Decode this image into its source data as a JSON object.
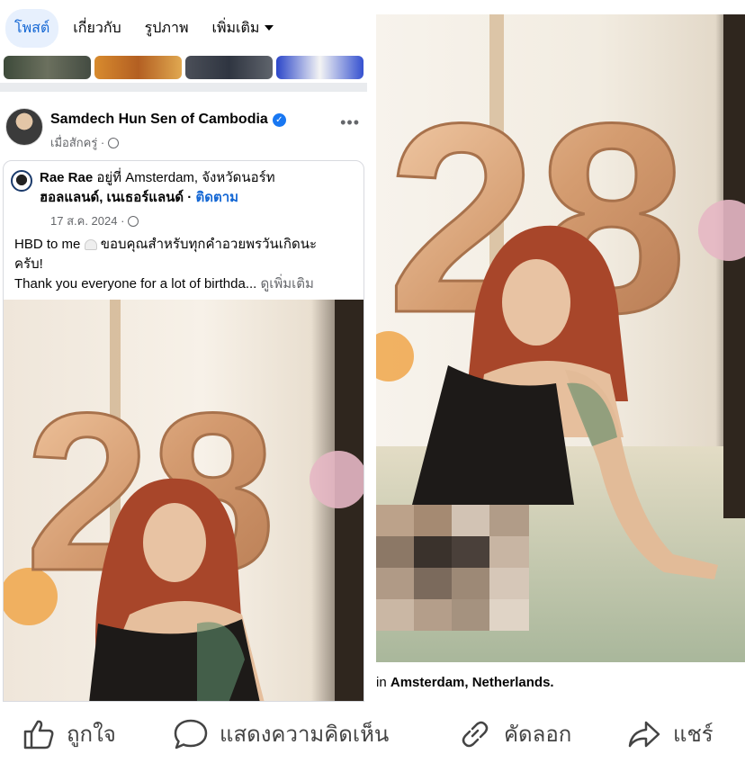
{
  "tabs": [
    {
      "label": "โพสต์",
      "active": true
    },
    {
      "label": "เกี่ยวกับ",
      "active": false
    },
    {
      "label": "รูปภาพ",
      "active": false
    },
    {
      "label": "เพิ่มเติม",
      "active": false
    }
  ],
  "post": {
    "author": "Samdech Hun Sen of Cambodia",
    "time": "เมื่อสักครู่ ·",
    "more_icon": "more-dots-icon"
  },
  "shared_post": {
    "author": "Rae Rae",
    "location_line1": "อยู่ที่ Amsterdam, จังหวัดนอร์ท",
    "location_line2": "ฮอลแลนด์, เนเธอร์แลนด์ ·",
    "follow": "ติดตาม",
    "date": "17 ส.ค. 2024 ·",
    "text_line1": "HBD to me",
    "text_line1_thai": "ขอบคุณสำหรับทุกคำอวยพรวันเกิดนะ",
    "text_line2": "ครับ!",
    "text_line3": "Thank you everyone for a lot of birthda...",
    "see_more": "ดูเพิ่มเติม",
    "balloon_number": "28"
  },
  "right_panel": {
    "caption_prefix": "in",
    "caption_place": "Amsterdam, Netherlands."
  },
  "actions": {
    "like": "ถูกใจ",
    "comment": "แสดงความคิดเห็น",
    "copy": "คัดลอก",
    "share": "แชร์"
  },
  "colors": {
    "accent": "#1467d4",
    "balloon": "#d9a57c",
    "hair": "#a8462a"
  }
}
